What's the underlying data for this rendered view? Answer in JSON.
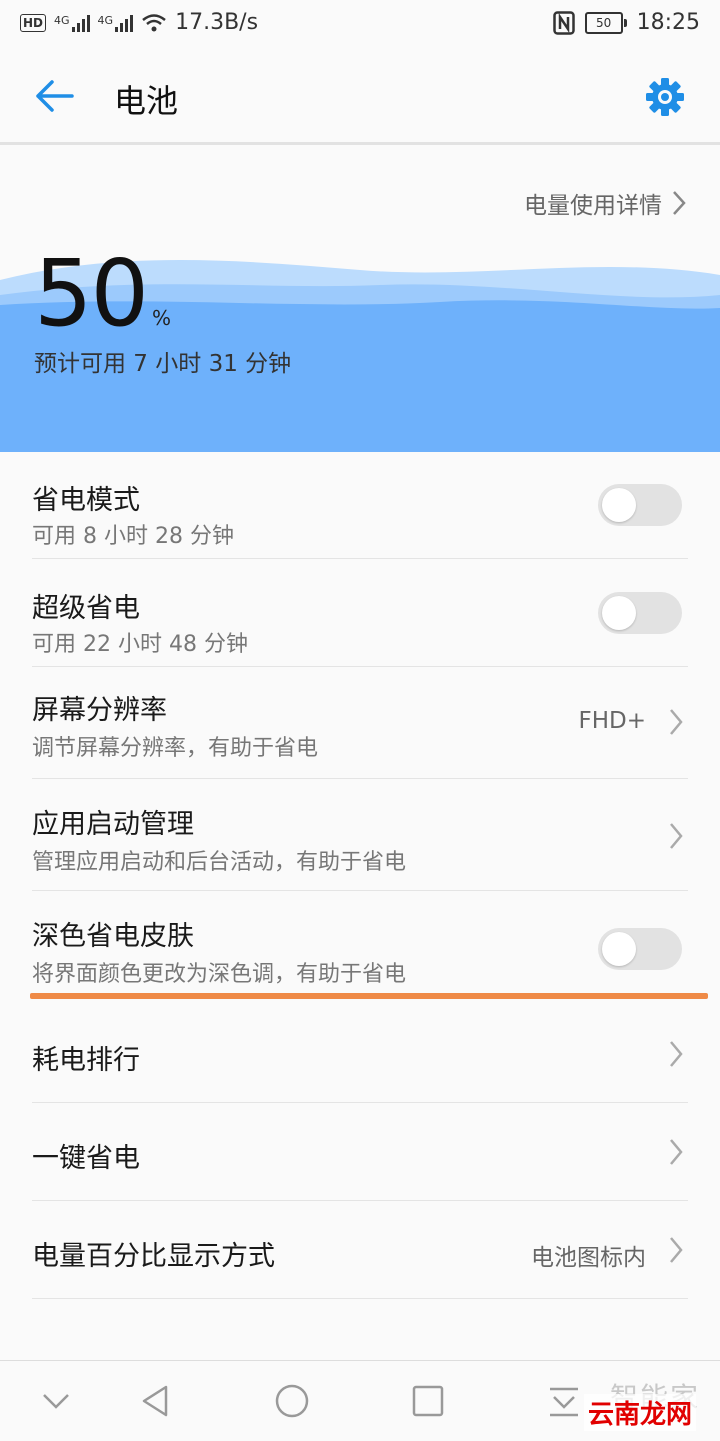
{
  "status": {
    "network_speed": "17.3B/s",
    "battery_level": "50",
    "time": "18:25",
    "hd": "HD",
    "net1": "4G",
    "net2": "4G"
  },
  "appbar": {
    "title": "电池"
  },
  "summary": {
    "detail_link": "电量使用详情",
    "percent": "50",
    "percent_unit": "%",
    "estimate": "预计可用 7 小时 31 分钟"
  },
  "items": [
    {
      "title": "省电模式",
      "subtitle": "可用 8 小时 28 分钟",
      "toggle": false
    },
    {
      "title": "超级省电",
      "subtitle": "可用 22 小时 48 分钟",
      "toggle": false
    },
    {
      "title": "屏幕分辨率",
      "subtitle": "调节屏幕分辨率，有助于省电",
      "value": "FHD+"
    },
    {
      "title": "应用启动管理",
      "subtitle": "管理应用启动和后台活动，有助于省电"
    },
    {
      "title": "深色省电皮肤",
      "subtitle": "将界面颜色更改为深色调，有助于省电",
      "toggle": false
    },
    {
      "title": "耗电排行"
    },
    {
      "title": "一键省电"
    },
    {
      "title": "电量百分比显示方式",
      "value": "电池图标内"
    }
  ],
  "watermark": {
    "line1": "智能家",
    "line2": "云南龙网"
  },
  "colors": {
    "accent": "#1f8ee6",
    "wave": "#6eb1fb",
    "highlight": "#ef8a47"
  }
}
